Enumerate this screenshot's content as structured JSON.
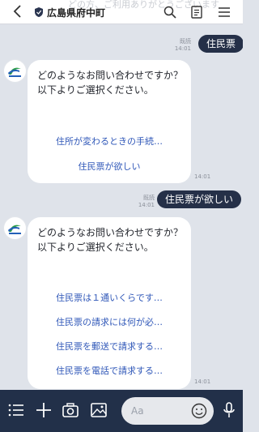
{
  "header": {
    "ghost_text": "どの方、ご利用ありがとうございます",
    "title": "広島県府中町",
    "icons": [
      "back-arrow-icon",
      "shield-icon",
      "search-icon",
      "notes-icon",
      "menu-icon"
    ]
  },
  "messages": {
    "sent1": {
      "text": "住民票",
      "read": "既読",
      "time": "14:01"
    },
    "bot1": {
      "question": "どのようなお問い合わせですか？\n以下よりご選択ください。",
      "options": [
        "住所が変わるときの手続…",
        "住民票が欲しい"
      ],
      "time": "14:01"
    },
    "sent2": {
      "text": "住民票が欲しい",
      "read": "既読",
      "time": "14:01"
    },
    "bot2": {
      "question": "どのようなお問い合わせですか？\n以下よりご選択ください。",
      "options": [
        "住民票は１通いくらです…",
        "住民票の請求には何が必…",
        "住民票を郵送で請求する…",
        "住民票を電話で請求する…"
      ],
      "time": "14:01"
    }
  },
  "input": {
    "placeholder": "Aa"
  },
  "colors": {
    "toolbar": "#223049",
    "bubble_out": "#253048",
    "link": "#2f57b8",
    "background": "#dfe3ea"
  },
  "toolbar_icons": [
    "menu-lines-icon",
    "plus-icon",
    "camera-icon",
    "image-icon",
    "emoji-icon",
    "microphone-icon"
  ]
}
